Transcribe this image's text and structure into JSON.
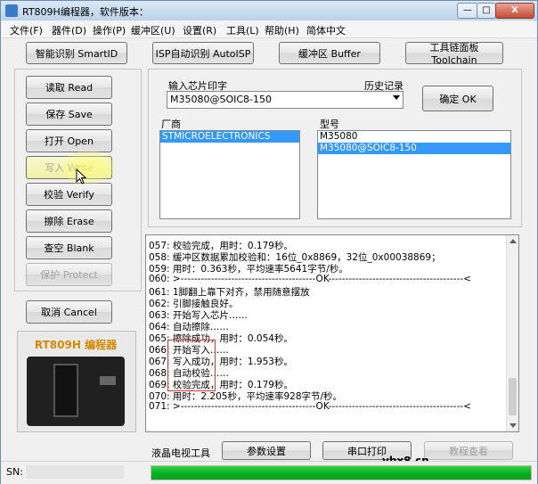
{
  "window": {
    "title": "RT809H编程器，软件版本："
  },
  "titlebar_buttons": {
    "minimize": "—",
    "maximize": "□",
    "close": "X"
  },
  "menu": [
    "文件(F)",
    "器件(D)",
    "操作(P)",
    "缓冲区(U)",
    "设置(R)",
    "工具(L)",
    "帮助(H)",
    "简体中文"
  ],
  "toolbar": {
    "smartid": "智能识别 SmartID",
    "autoisp": "ISP自动识别 AutoISP",
    "buffer": "缓冲区 Buffer",
    "toolchain": "工具链面板 Toolchain"
  },
  "actions": {
    "read": "读取 Read",
    "save": "保存 Save",
    "open": "打开 Open",
    "write": "写入 Write",
    "verify": "校验 Verify",
    "erase": "擦除 Erase",
    "blank": "查空 Blank",
    "protect": "保护 Protect",
    "cancel": "取消 Cancel"
  },
  "device_panel": {
    "label": "RT809H 编程器"
  },
  "chip": {
    "input_label": "输入芯片印字",
    "history_label": "历史记录",
    "value": "M35080@SOIC8-150",
    "ok": "确定 OK",
    "vendor_label": "厂商",
    "model_label": "型号",
    "vendors": [
      "STMICROELECTRONICS"
    ],
    "models": [
      "M35080",
      "M35080@SOIC8-150"
    ]
  },
  "log": [
    "057: 校验完成，用时：0.179秒。",
    "058: 缓冲区数据累加校验和：16位_0x8869，32位_0x00038869；",
    "059: 用时：0.363秒，平均速率5641字节/秒。",
    "060: >----------------------------------------OK----------------------------------------<",
    "061: 1脚翻上靠下对齐，禁用随意摆放",
    "062: 引脚接触良好。",
    "063: 开始写入芯片……",
    "064: 自动擦除……",
    "065: 擦除成功，用时：0.054秒。",
    "066: 开始写入……",
    "067: 写入成功，用时：1.953秒。",
    "068: 自动校验……",
    "069: 校验完成，用时：0.179秒。",
    "070: 用时：2.205秒，平均速率928字节/秒。",
    "071: >----------------------------------------OK----------------------------------------<"
  ],
  "bottom": {
    "lcd_tools": "液晶电视工具",
    "params": "参数设置",
    "serial": "串口打印",
    "tutorial": "教程查看"
  },
  "status": {
    "sn_label": "SN:",
    "progress_percent": 100
  },
  "watermark": "ybx8.cn"
}
